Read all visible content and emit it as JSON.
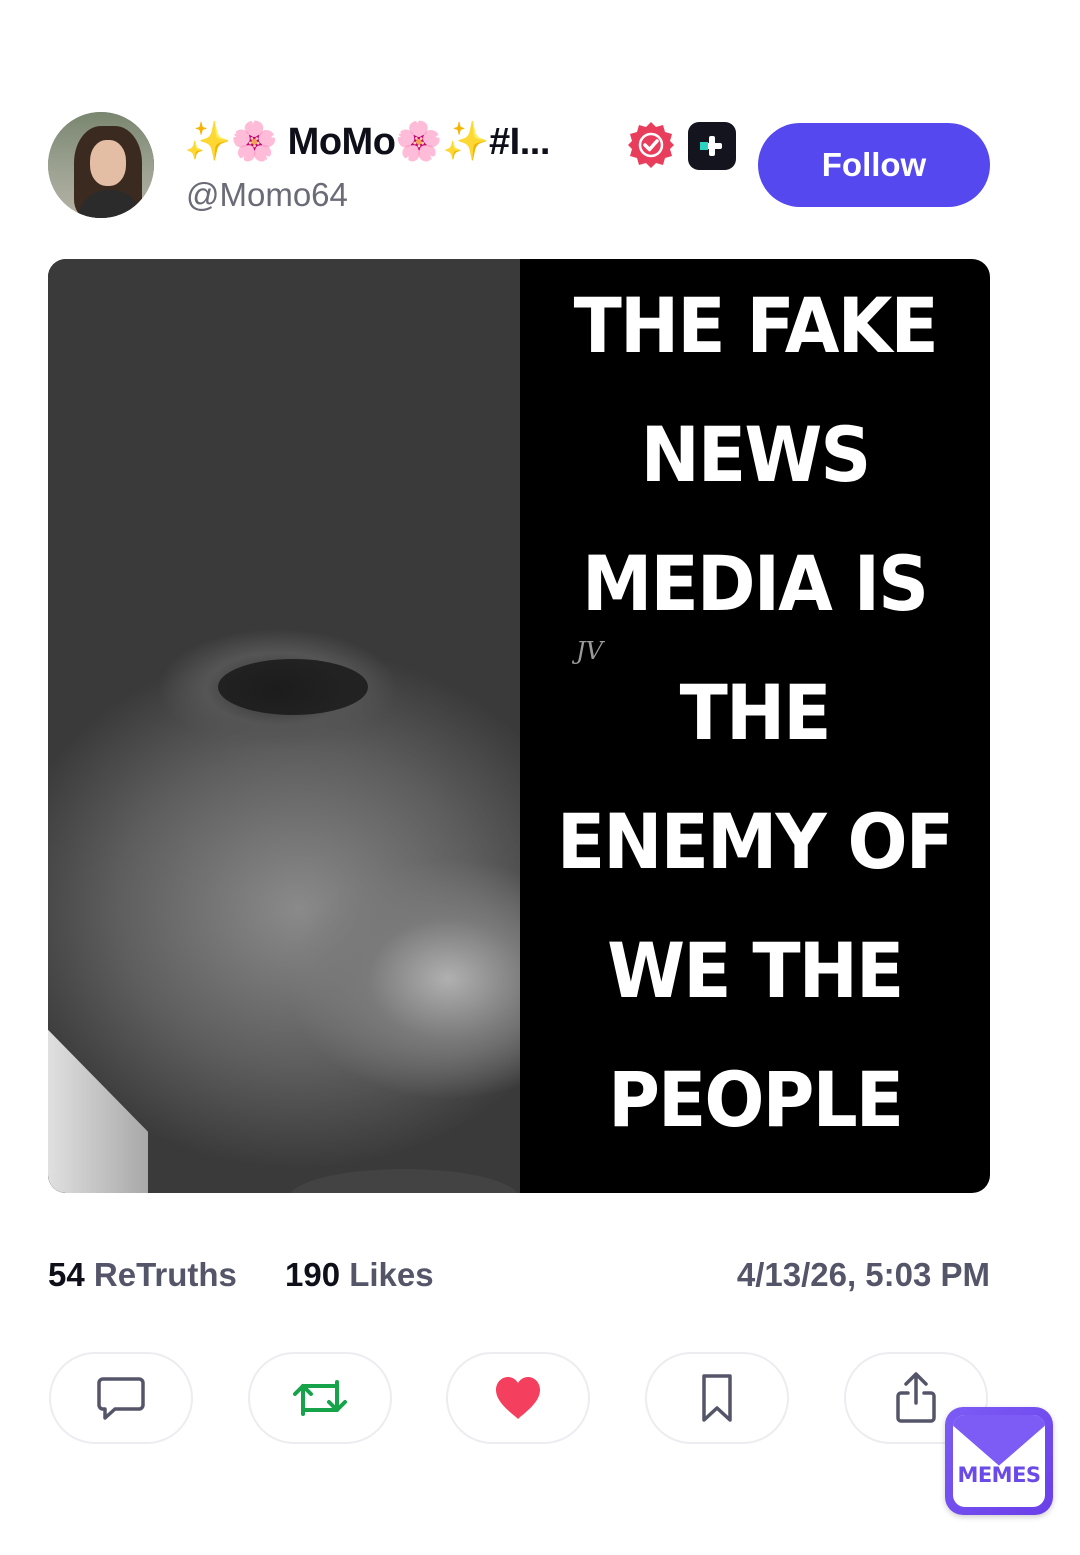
{
  "author": {
    "display_name": "✨🌸 MoMo🌸✨#I...",
    "handle": "@Momo64",
    "verified_icon": "verified-badge-icon",
    "verified_color": "#e83e5c",
    "premium_icon": "plus-badge-icon"
  },
  "follow": {
    "label": "Follow",
    "color": "#5448ee"
  },
  "post": {
    "image_text_lines": [
      "THE FAKE",
      "NEWS",
      "MEDIA IS",
      "THE",
      "ENEMY OF",
      "WE THE",
      "PEOPLE"
    ],
    "signature": "JV"
  },
  "stats": {
    "retruths_count": "54",
    "retruths_label": "ReTruths",
    "likes_count": "190",
    "likes_label": "Likes",
    "timestamp": "4/13/26, 5:03 PM"
  },
  "actions": {
    "reply_icon": "comment-icon",
    "retruth_icon": "retruth-icon",
    "retruth_color": "#16a34a",
    "like_icon": "heart-icon",
    "like_color": "#f43f5e",
    "bookmark_icon": "bookmark-icon",
    "share_icon": "share-icon"
  },
  "watermark": {
    "label": "MEMES"
  }
}
